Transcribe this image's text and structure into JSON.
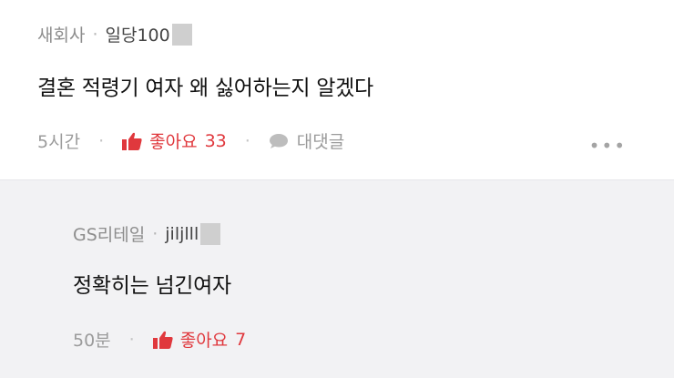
{
  "comment": {
    "company": "새회사",
    "author": "일당100",
    "text": "결혼 적령기 여자 왜 싫어하는지 알겠다",
    "time": "5시간",
    "like_label": "좋아요",
    "like_count": "33",
    "reply_label": "대댓글",
    "more": "•••"
  },
  "reply": {
    "company": "GS리테일",
    "author": "jiljlll",
    "text": "정확히는 넘긴여자",
    "time": "50분",
    "like_label": "좋아요",
    "like_count": "7"
  },
  "separator": "·",
  "colors": {
    "accent": "#e0383d",
    "muted": "#9b9b9b",
    "reply_bg": "#f2f2f4"
  },
  "icons": {
    "like": "thumbs-up-icon",
    "reply": "speech-bubble-icon",
    "more": "more-dots-icon"
  }
}
